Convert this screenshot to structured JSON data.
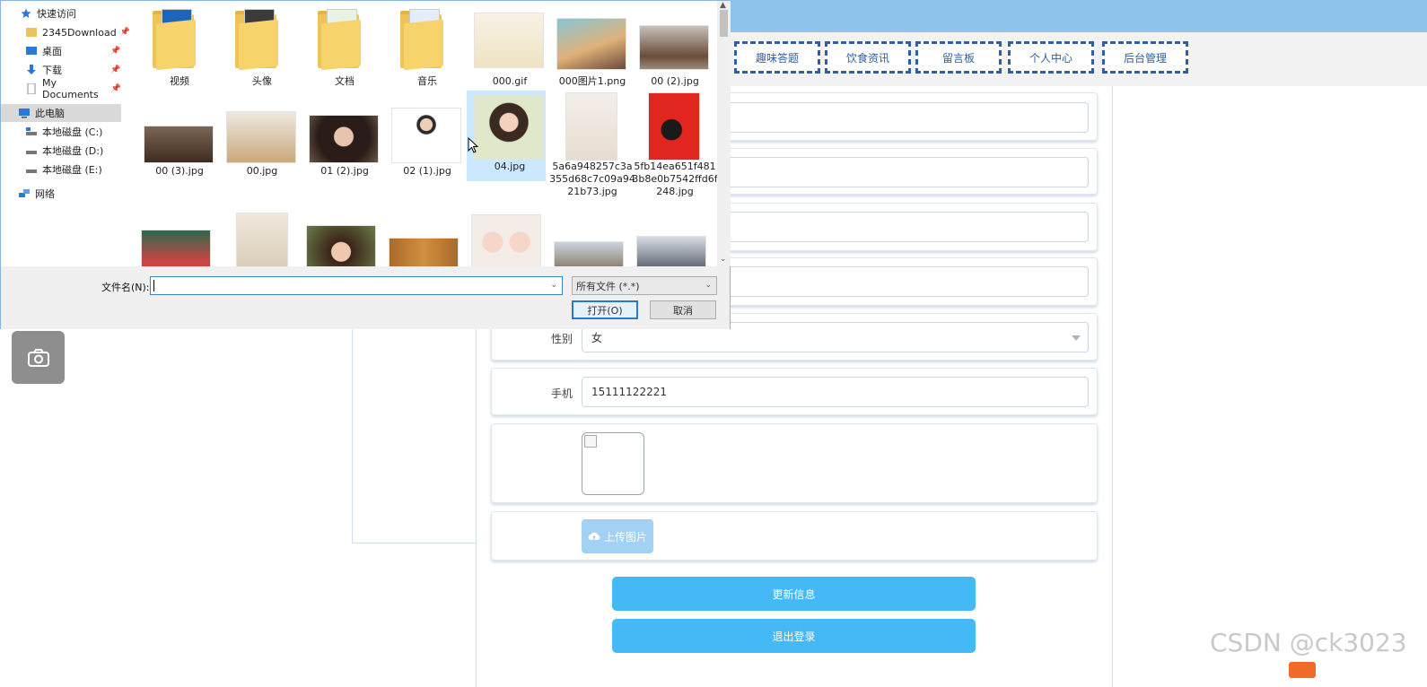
{
  "nav": {
    "items": [
      "趣味答题",
      "饮食资讯",
      "留言板",
      "个人中心",
      "后台管理"
    ]
  },
  "form": {
    "gender_label": "性别",
    "gender_value": "女",
    "phone_label": "手机",
    "phone_value": "15111122221",
    "upload_label": "上传图片",
    "update_button": "更新信息",
    "logout_button": "退出登录"
  },
  "watermark": "CSDN @ck3023",
  "dialog": {
    "sidebar": {
      "quick_access": "快速访问",
      "items": [
        {
          "label": "2345Download",
          "pinned": true
        },
        {
          "label": "桌面",
          "pinned": true
        },
        {
          "label": "下载",
          "pinned": true
        },
        {
          "label": "My Documents",
          "pinned": true
        }
      ],
      "this_pc": "此电脑",
      "drives": [
        "本地磁盘 (C:)",
        "本地磁盘 (D:)",
        "本地磁盘 (E:)"
      ],
      "network": "网络"
    },
    "files_row1": [
      "视频",
      "头像",
      "文档",
      "音乐",
      "000.gif",
      "000图片1.png",
      "00 (2).jpg"
    ],
    "files_row2": [
      "00 (3).jpg",
      "00.jpg",
      "01 (2).jpg",
      "02 (1).jpg",
      "04.jpg",
      "5a6a948257c3a355d68c7c09a9421b73.jpg",
      "5fb14ea651f4813b8e0b7542ffd6f248.jpg"
    ],
    "selected_file": "04.jpg",
    "filename_label": "文件名(N):",
    "filename_value": "",
    "filetype_value": "所有文件 (*.*)",
    "open_button": "打开(O)",
    "cancel_button": "取消"
  },
  "colors": {
    "topbar": "#8ec3ec",
    "nav_border": "#2f5f9e",
    "primary_button": "#45b8f6",
    "upload_button": "#a3d1f3",
    "selection": "#cce8ff"
  }
}
